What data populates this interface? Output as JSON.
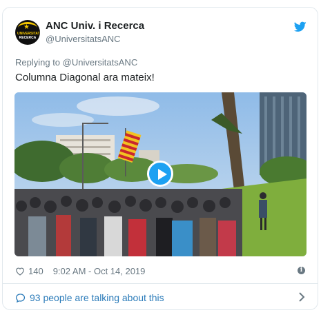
{
  "account": {
    "name": "ANC Univ. i Recerca",
    "handle": "@UniversitatsANC",
    "avatar_text_top": "UNIVERSITATS",
    "avatar_text_bottom": "RECERCA"
  },
  "tweet": {
    "replying_to": "Replying to @UniversitatsANC",
    "text": "Columna Diagonal ara mateix!"
  },
  "media": {
    "type": "video"
  },
  "meta": {
    "likes": "140",
    "timestamp": "9:02 AM - Oct 14, 2019"
  },
  "footer": {
    "talking": "93 people are talking about this"
  },
  "colors": {
    "accent": "#1da1f2",
    "link": "#2b7bb9",
    "muted": "#697882",
    "border": "#e1e8ed"
  },
  "icons": {
    "brand": "twitter-bird-icon",
    "like": "heart-icon",
    "info": "info-icon",
    "reply": "speech-bubble-icon",
    "more": "chevron-right-icon",
    "play": "play-icon"
  }
}
